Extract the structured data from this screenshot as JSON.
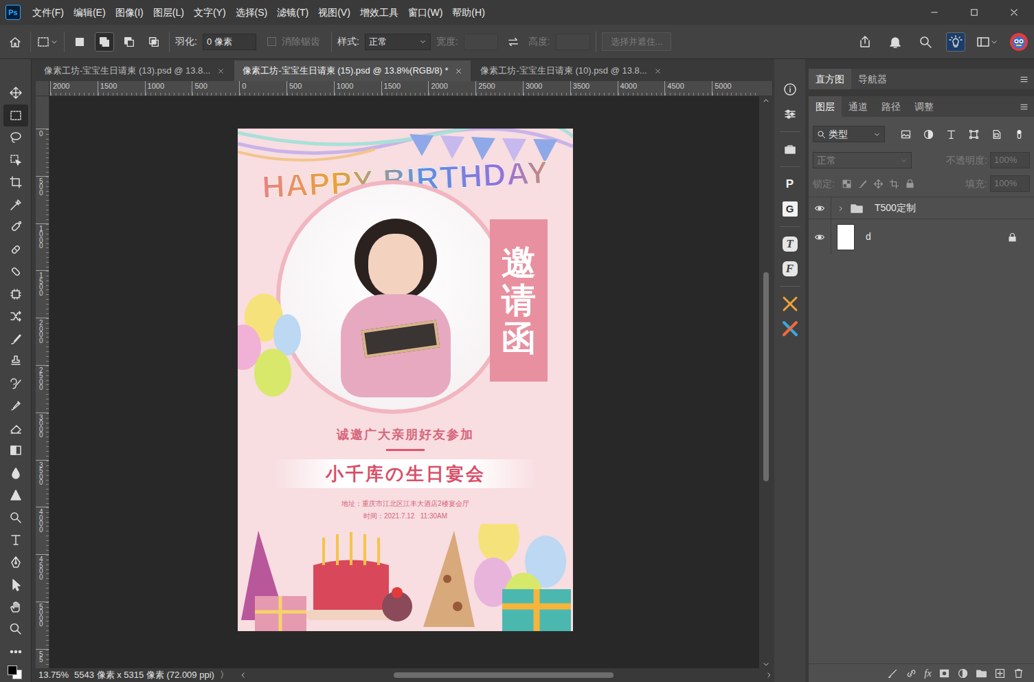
{
  "app": {
    "logo": "Ps"
  },
  "menu": [
    "文件(F)",
    "编辑(E)",
    "图像(I)",
    "图层(L)",
    "文字(Y)",
    "选择(S)",
    "滤镜(T)",
    "视图(V)",
    "增效工具",
    "窗口(W)",
    "帮助(H)"
  ],
  "options": {
    "selection_modes": [
      {
        "selected": false
      },
      {
        "selected": true
      },
      {
        "selected": false
      },
      {
        "selected": false
      }
    ],
    "feather": {
      "label": "羽化:",
      "value": "0 像素"
    },
    "antialias": {
      "label": "消除锯齿",
      "checked": false,
      "disabled": true
    },
    "style": {
      "label": "样式:",
      "value": "正常"
    },
    "width": {
      "label": "宽度:",
      "value": "",
      "disabled": true
    },
    "height": {
      "label": "高度:",
      "value": "",
      "disabled": true
    },
    "mask_button": {
      "label": "选择并遮住...",
      "disabled": true
    },
    "discover": {
      "selected": true
    }
  },
  "tools": [
    {
      "selected": false
    },
    {
      "selected": true
    },
    {
      "selected": false
    },
    {
      "selected": false
    },
    {
      "selected": false
    },
    {
      "selected": false
    },
    {
      "selected": false
    },
    {
      "selected": false
    },
    {
      "selected": false
    },
    {
      "selected": false
    },
    {
      "selected": false
    },
    {
      "selected": false
    },
    {
      "selected": false
    },
    {
      "selected": false
    },
    {
      "selected": false
    },
    {
      "selected": false
    },
    {
      "selected": false
    },
    {
      "selected": false
    },
    {
      "selected": false
    },
    {
      "selected": false
    },
    {
      "selected": false
    },
    {
      "selected": false
    },
    {
      "selected": false
    },
    {
      "selected": false
    },
    {
      "selected": false
    },
    {
      "selected": false
    }
  ],
  "colors": {
    "foreground": "#000000",
    "background": "#ffffff"
  },
  "tabs": [
    {
      "label": "像素工坊-宝宝生日请柬 (13).psd @ 13.8...",
      "selected": false
    },
    {
      "label": "像素工坊-宝宝生日请柬 (15).psd @ 13.8%(RGB/8) *",
      "selected": true
    },
    {
      "label": "像素工坊-宝宝生日请柬 (10).psd @ 13.8...",
      "selected": false
    }
  ],
  "ruler": {
    "top": [
      "2000",
      "1500",
      "1000",
      "500",
      "0",
      "500",
      "1000",
      "1500",
      "2000",
      "2500",
      "3000",
      "3500",
      "4000",
      "4500",
      "5000"
    ],
    "left": [
      "0",
      "500",
      "1000",
      "1500",
      "2000",
      "2500",
      "3000",
      "3500",
      "4000",
      "4500",
      "5000",
      "55"
    ]
  },
  "document": {
    "title": "HAPPY BIRTHDAY",
    "badge": "邀请函",
    "invite": "诚邀广大亲朋好友参加",
    "event": "小千库の生日宴会",
    "address": "地址：重庆市江北区江丰大酒店2楼宴会厅",
    "time": "时间：2021.7.12   11:30AM"
  },
  "scroll": {
    "vertical": {
      "start": 0.3,
      "level": 0.38
    },
    "horizontal": {
      "start": 0.28,
      "level": 0.43
    }
  },
  "status": {
    "zoom": "13.75%",
    "info": "5543 像素 x 5315 像素 (72.009 ppi)",
    "arrow": "〉"
  },
  "plugins": [
    "P",
    "G",
    "T",
    "F"
  ],
  "panels": {
    "top_tabs": [
      {
        "label": "直方图",
        "selected": true
      },
      {
        "label": "导航器",
        "selected": false
      }
    ],
    "layer_tabs": [
      {
        "label": "图层",
        "selected": true
      },
      {
        "label": "通道",
        "selected": false
      },
      {
        "label": "路径",
        "selected": false
      },
      {
        "label": "调整",
        "selected": false
      }
    ],
    "filter": {
      "label": "类型"
    },
    "blend_mode": {
      "value": "正常",
      "disabled": true
    },
    "opacity": {
      "label": "不透明度:",
      "value": "100%",
      "disabled": true
    },
    "lock": {
      "label": "锁定:"
    },
    "fill": {
      "label": "填充:",
      "value": "100%",
      "disabled": true
    },
    "footer_fx": "fx"
  },
  "layers": [
    {
      "name": "T500定制",
      "kind": "group",
      "visible": true,
      "expanded": false,
      "locked": false
    },
    {
      "name": "d",
      "kind": "layer",
      "visible": true,
      "locked": true
    }
  ]
}
